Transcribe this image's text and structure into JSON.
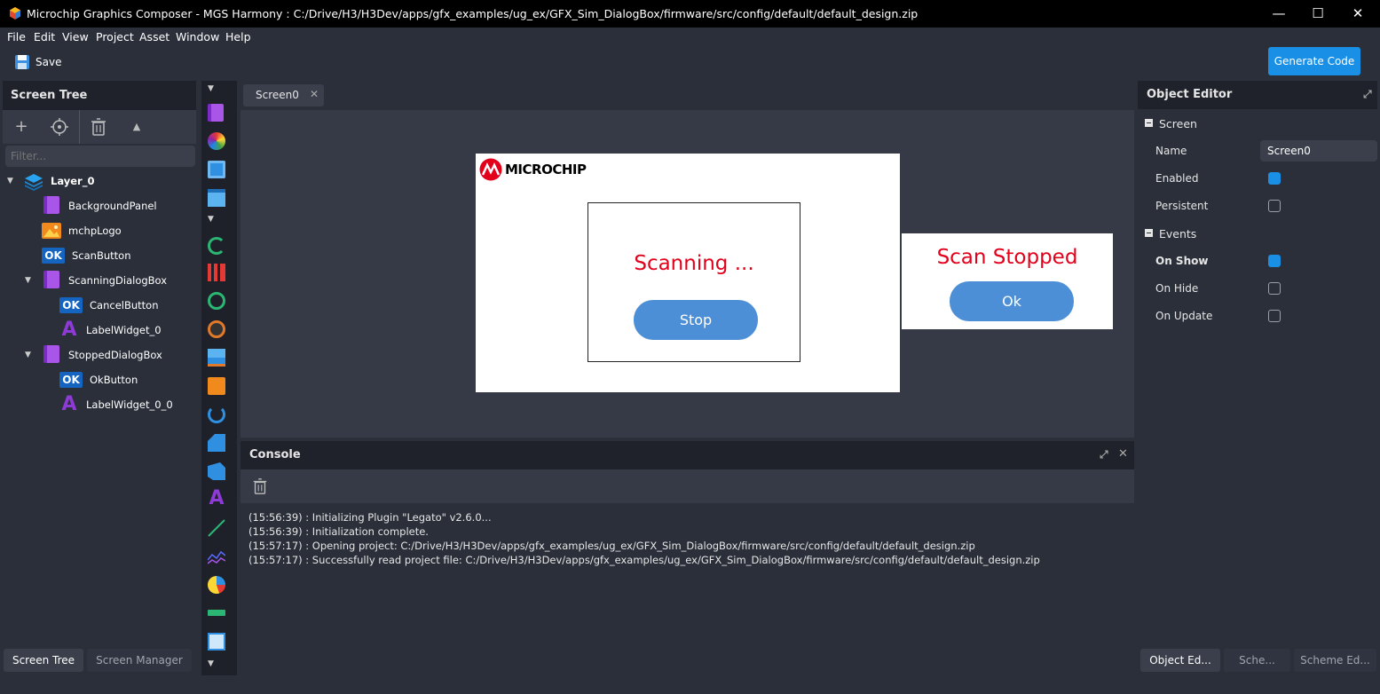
{
  "window": {
    "title": "Microchip Graphics Composer - MGS Harmony : C:/Drive/H3/H3Dev/apps/gfx_examples/ug_ex/GFX_Sim_DialogBox/firmware/src/config/default/default_design.zip",
    "minimize": "—",
    "maximize": "☐",
    "close": "✕"
  },
  "menu": [
    "File",
    "Edit",
    "View",
    "Project",
    "Asset",
    "Window",
    "Help"
  ],
  "toolbar": {
    "save_label": "Save",
    "generate_label": "Generate Code"
  },
  "screen_tree": {
    "title": "Screen Tree",
    "filter_placeholder": "Filter...",
    "items": [
      {
        "label": "Layer_0",
        "icon": "layer-icon"
      },
      {
        "label": "BackgroundPanel",
        "icon": "panel-icon"
      },
      {
        "label": "mchpLogo",
        "icon": "image-icon"
      },
      {
        "label": "ScanButton",
        "icon": "button-icon",
        "badge": "OK"
      },
      {
        "label": "ScanningDialogBox",
        "icon": "panel-icon"
      },
      {
        "label": "CancelButton",
        "icon": "button-icon",
        "badge": "OK"
      },
      {
        "label": "LabelWidget_0",
        "icon": "label-icon",
        "badge": "A"
      },
      {
        "label": "StoppedDialogBox",
        "icon": "panel-icon"
      },
      {
        "label": "OkButton",
        "icon": "button-icon",
        "badge": "OK"
      },
      {
        "label": "LabelWidget_0_0",
        "icon": "label-icon",
        "badge": "A"
      }
    ],
    "bottom_tabs": [
      "Screen Tree",
      "Screen Manager"
    ]
  },
  "editor": {
    "tab_label": "Screen0",
    "canvas": {
      "logo_text": "MICROCHIP",
      "scanning_label": "Scanning ...",
      "stop_button": "Stop",
      "stopped_label": "Scan Stopped",
      "ok_button": "Ok"
    }
  },
  "console": {
    "title": "Console",
    "lines": [
      "(15:56:39) : Initializing Plugin \"Legato\" v2.6.0...",
      "(15:56:39) : Initialization complete.",
      "(15:57:17) : Opening project: C:/Drive/H3/H3Dev/apps/gfx_examples/ug_ex/GFX_Sim_DialogBox/firmware/src/config/default/default_design.zip",
      "(15:57:17) : Successfully read project file: C:/Drive/H3/H3Dev/apps/gfx_examples/ug_ex/GFX_Sim_DialogBox/firmware/src/config/default/default_design.zip"
    ]
  },
  "object_editor": {
    "title": "Object Editor",
    "section_screen": "Screen",
    "name_label": "Name",
    "name_value": "Screen0",
    "enabled_label": "Enabled",
    "persistent_label": "Persistent",
    "section_events": "Events",
    "on_show_label": "On Show",
    "on_hide_label": "On Hide",
    "on_update_label": "On Update",
    "bottom_tabs": [
      "Object Ed...",
      "Sche...",
      "Scheme Ed..."
    ]
  },
  "colors": {
    "accent": "#1a8fe6",
    "dialog_text": "#e3001b",
    "button_fill": "#4d8fd6"
  }
}
